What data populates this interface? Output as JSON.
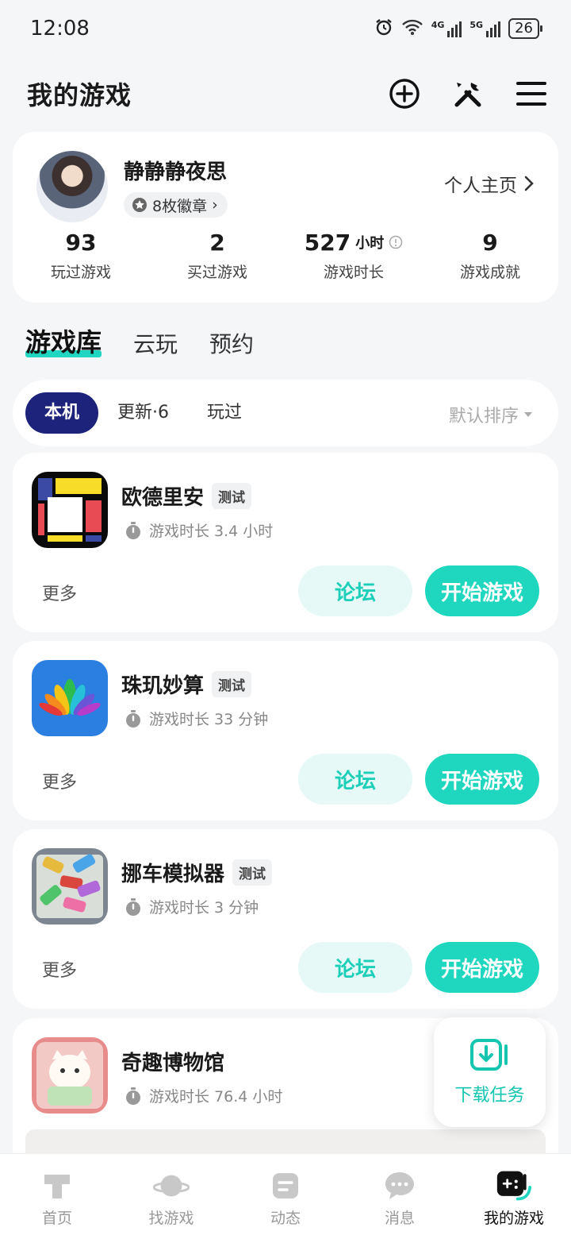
{
  "status": {
    "time": "12:08",
    "battery": "26",
    "net1": "4G",
    "net2": "5G"
  },
  "header": {
    "title": "我的游戏"
  },
  "profile": {
    "username": "静静静夜思",
    "badges": "8枚徽章",
    "homepage": "个人主页",
    "stats": [
      {
        "value": "93",
        "unit": "",
        "label": "玩过游戏"
      },
      {
        "value": "2",
        "unit": "",
        "label": "买过游戏"
      },
      {
        "value": "527",
        "unit": "小时",
        "label": "游戏时长"
      },
      {
        "value": "9",
        "unit": "",
        "label": "游戏成就"
      }
    ]
  },
  "library_tabs": [
    "游戏库",
    "云玩",
    "预约"
  ],
  "filters": {
    "items": [
      "本机",
      "更新·6",
      "玩过"
    ],
    "sort": "默认排序"
  },
  "games": [
    {
      "name": "欧德里安",
      "tag": "测试",
      "playtime": "游戏时长 3.4 小时",
      "more": "更多",
      "forum": "论坛",
      "play": "开始游戏"
    },
    {
      "name": "珠玑妙算",
      "tag": "测试",
      "playtime": "游戏时长 33 分钟",
      "more": "更多",
      "forum": "论坛",
      "play": "开始游戏"
    },
    {
      "name": "挪车模拟器",
      "tag": "测试",
      "playtime": "游戏时长 3 分钟",
      "more": "更多",
      "forum": "论坛",
      "play": "开始游戏"
    },
    {
      "name": "奇趣博物馆",
      "playtime": "游戏时长 76.4 小时"
    }
  ],
  "download_fab": {
    "label": "下载任务"
  },
  "bottom_nav": [
    "首页",
    "找游戏",
    "动态",
    "消息",
    "我的游戏"
  ],
  "colors": {
    "accent": "#1fd6bf",
    "filter_active": "#1d237a"
  }
}
